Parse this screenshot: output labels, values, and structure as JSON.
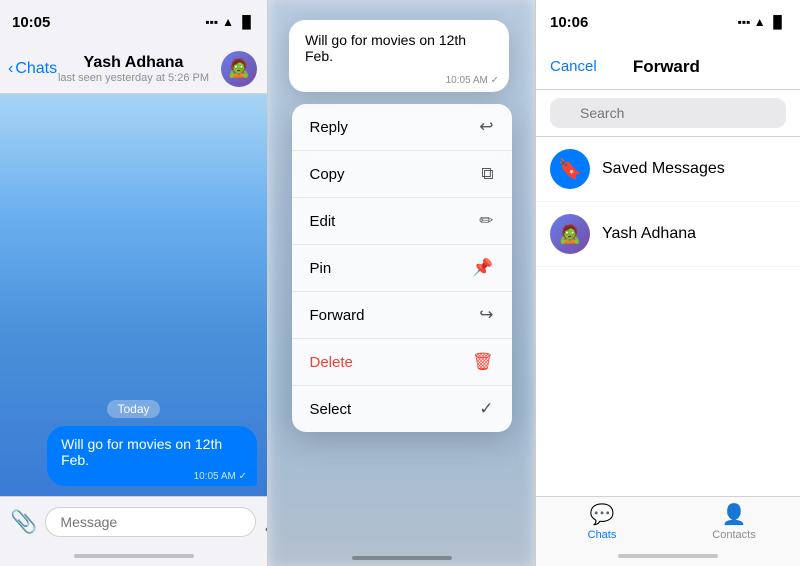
{
  "panel1": {
    "status_time": "10:05",
    "signal_icons": "●●●  ▲  🔋",
    "back_label": "Chats",
    "contact_name": "Yash Adhana",
    "contact_status": "last seen yesterday at 5:26 PM",
    "avatar_emoji": "🧟",
    "date_label": "Today",
    "message_text": "Will go for movies on 12th Feb.",
    "message_time": "10:05 AM ✓",
    "input_placeholder": "Message",
    "attach_icon": "📎",
    "audio_icon": "🎤"
  },
  "panel2": {
    "bubble_text": "Will go for movies on 12th Feb.",
    "bubble_time": "10:05 AM ✓",
    "menu_items": [
      {
        "label": "Reply",
        "icon": "↩",
        "type": "normal"
      },
      {
        "label": "Copy",
        "icon": "⧉",
        "type": "normal"
      },
      {
        "label": "Edit",
        "icon": "✏",
        "type": "normal"
      },
      {
        "label": "Pin",
        "icon": "📌",
        "type": "normal"
      },
      {
        "label": "Forward",
        "icon": "↪",
        "type": "normal"
      },
      {
        "label": "Delete",
        "icon": "🗑",
        "type": "delete"
      },
      {
        "label": "Select",
        "icon": "✓",
        "type": "normal"
      }
    ]
  },
  "panel3": {
    "status_time": "10:06",
    "signal_icons": "●●●  ▲  🔋",
    "cancel_label": "Cancel",
    "title": "Forward",
    "search_placeholder": "Search",
    "contacts": [
      {
        "name": "Saved Messages",
        "type": "saved"
      },
      {
        "name": "Yash Adhana",
        "type": "yash"
      }
    ],
    "tab_chats_label": "Chats",
    "tab_contacts_label": "Contacts",
    "chat_icon": "💬",
    "contacts_icon": "👤"
  }
}
